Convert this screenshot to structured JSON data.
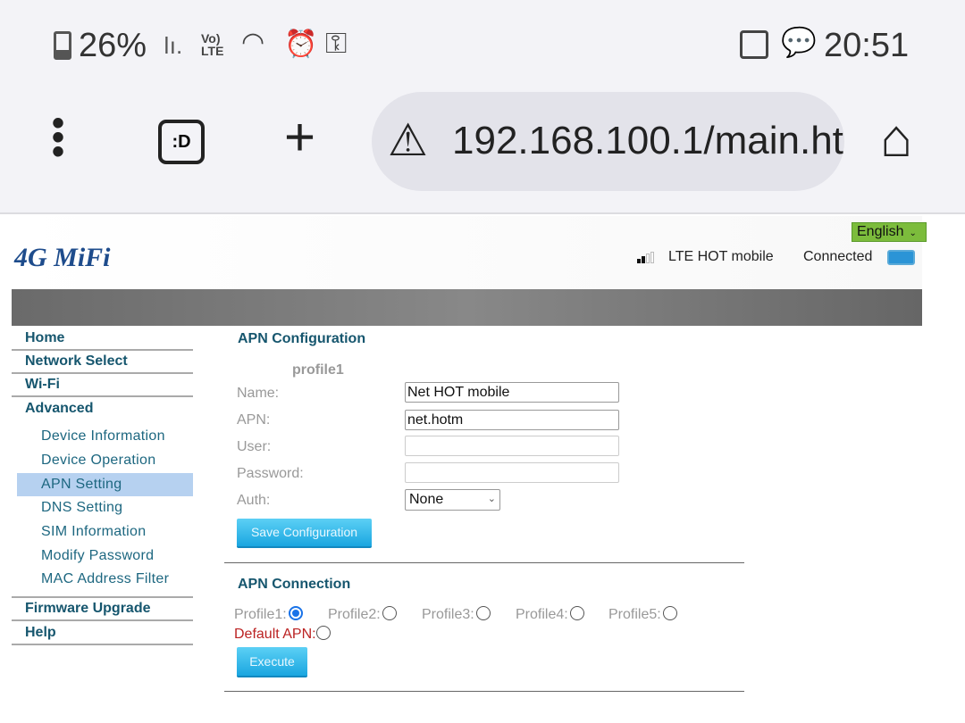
{
  "status_bar": {
    "battery": "26%",
    "network": "LTE",
    "time": "20:51"
  },
  "browser": {
    "url": "192.168.100.1/main.ht",
    "tab_icon": ":D"
  },
  "header": {
    "logo": "4G MiFi",
    "language": "English",
    "carrier": "LTE HOT mobile",
    "connection": "Connected",
    "signal_level": 0.5
  },
  "sidebar": {
    "items": [
      "Home",
      "Network Select",
      "Wi-Fi",
      "Advanced"
    ],
    "sub_items": [
      "Device Information",
      "Device Operation",
      "APN Setting",
      "DNS Setting",
      "SIM Information",
      "Modify Password",
      "MAC Address Filter"
    ],
    "bottom_items": [
      "Firmware Upgrade",
      "Help"
    ],
    "active": "APN Setting"
  },
  "apn_config": {
    "title": "APN Configuration",
    "profile": "profile1",
    "labels": {
      "name": "Name:",
      "apn": "APN:",
      "user": "User:",
      "password": "Password:",
      "auth": "Auth:"
    },
    "values": {
      "name": "Net HOT mobile",
      "apn": "net.hotm",
      "user": "",
      "password": "",
      "auth": "None"
    },
    "save": "Save Configuration"
  },
  "apn_connection": {
    "title": "APN Connection",
    "profiles": [
      "Profile1:",
      "Profile2:",
      "Profile3:",
      "Profile4:",
      "Profile5:"
    ],
    "selected": "Profile1:",
    "default_apn": "Default APN:",
    "execute": "Execute"
  }
}
